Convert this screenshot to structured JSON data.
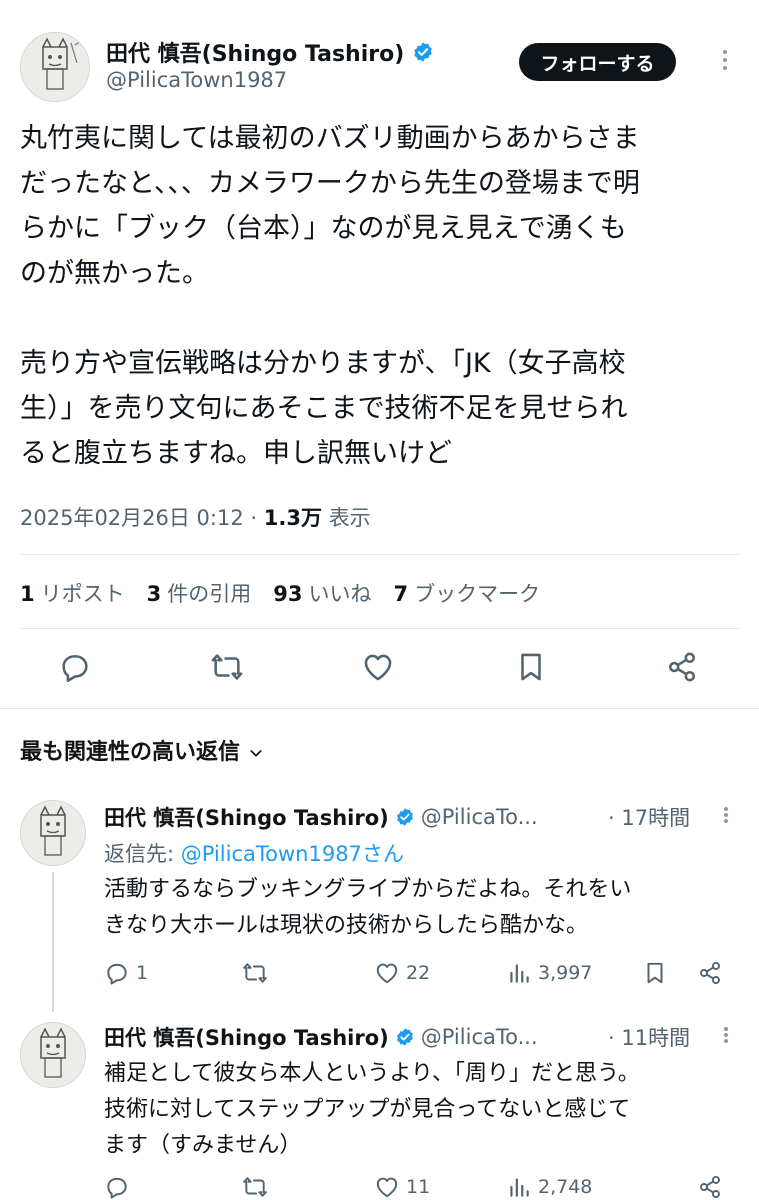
{
  "post": {
    "author_name": "田代 慎吾(Shingo Tashiro)",
    "author_handle": "@PilicaTown1987",
    "follow_label": "フォローする",
    "body_lines": [
      "丸竹夷に関しては最初のバズリ動画からあからさま",
      "だったなと、、、カメラワークから先生の登場まで明",
      "らかに「ブック（台本）」なのが見え見えで湧くも",
      "のが無かった。",
      "",
      "売り方や宣伝戦略は分かりますが、「JK（女子高校",
      "生）」を売り文句にあそこまで技術不足を見せられ",
      "ると腹立ちますね。申し訳無いけど"
    ],
    "timestamp": "2025年02月26日 0:12",
    "separator": "·",
    "views_count": "1.3万",
    "views_label": "表示",
    "stats": {
      "reposts_count": "1",
      "reposts_label": "リポスト",
      "quotes_count": "3",
      "quotes_label": "件の引用",
      "likes_count": "93",
      "likes_label": "いいね",
      "bookmarks_count": "7",
      "bookmarks_label": "ブックマーク"
    }
  },
  "replies_header": {
    "sort_label": "最も関連性の高い返信"
  },
  "replies": [
    {
      "author_name": "田代 慎吾(Shingo Tashiro)",
      "author_handle": "@PilicaTo...",
      "time": "· 17時間",
      "reply_to_prefix": "返信先:",
      "reply_to_handle": "@PilicaTown1987さん",
      "text_lines": [
        "活動するならブッキングライブからだよね。それをい",
        "きなり大ホールは現状の技術からしたら酷かな。"
      ],
      "replies_count": "1",
      "reposts_count": "",
      "likes_count": "22",
      "views_count": "3,997"
    },
    {
      "author_name": "田代 慎吾(Shingo Tashiro)",
      "author_handle": "@PilicaTo...",
      "time": "· 11時間",
      "text_lines": [
        "補足として彼女ら本人というより、「周り」だと思う。",
        "技術に対してステップアップが見合ってないと感じて",
        "ます（すみません）"
      ],
      "replies_count": "",
      "reposts_count": "",
      "likes_count": "11",
      "views_count": "2,748"
    }
  ],
  "colors": {
    "text": "#0f1419",
    "muted": "#536471",
    "link": "#1d9bf0",
    "verified": "#1d9bf0"
  },
  "icons": [
    "reply-icon",
    "repost-icon",
    "like-icon",
    "bookmark-icon",
    "share-icon",
    "views-icon",
    "verified-icon",
    "more-icon",
    "chevron-down-icon"
  ]
}
